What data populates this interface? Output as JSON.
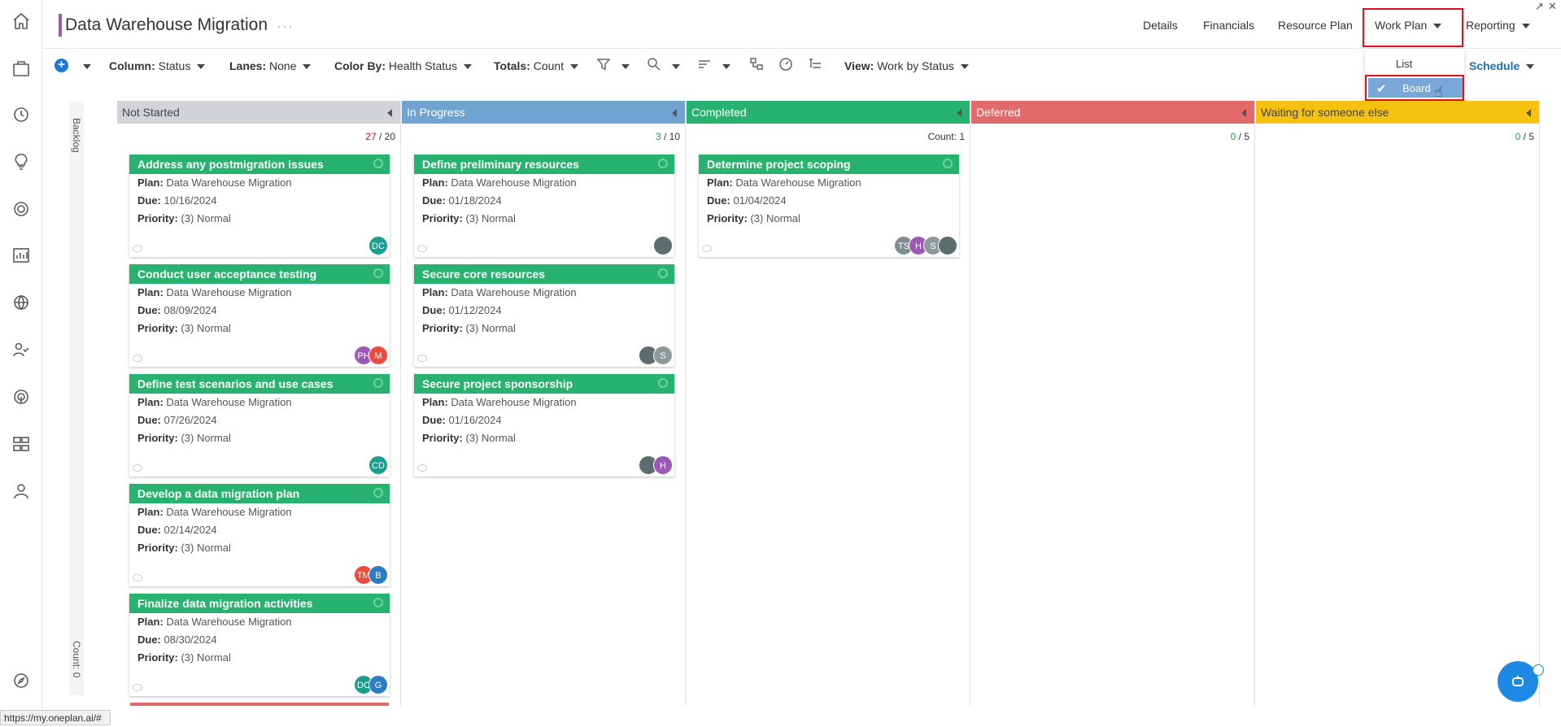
{
  "header": {
    "title": "Data Warehouse Migration",
    "more": "···",
    "nav": {
      "details": "Details",
      "financials": "Financials",
      "resource_plan": "Resource Plan",
      "work_plan": "Work Plan",
      "reporting": "Reporting"
    }
  },
  "toolbar": {
    "column_label": "Column:",
    "column_value": "Status",
    "lanes_label": "Lanes:",
    "lanes_value": "None",
    "color_label": "Color By:",
    "color_value": "Health Status",
    "totals_label": "Totals:",
    "totals_value": "Count",
    "view_label": "View:",
    "view_value": "Work by Status",
    "schedule": "Schedule"
  },
  "work_plan_menu": {
    "list": "List",
    "board": "Board",
    "selected": "Board"
  },
  "backlog": {
    "label": "Backlog",
    "count": "Count: 0"
  },
  "colors": {
    "accent": "#1e78d6",
    "card_header": "#27b36f",
    "highlight": "#e0111a",
    "title_bar": "#9b59b6"
  },
  "columns": [
    {
      "name": "Not Started",
      "color": "#d2d4d8",
      "count_current": "27",
      "count_sep": " / ",
      "count_limit": "20",
      "count_class": "count-red",
      "cards": [
        {
          "title": "Address any postmigration issues",
          "plan": "Data Warehouse Migration",
          "due": "10/16/2024",
          "priority": "(3) Normal",
          "avatars": [
            {
              "t": "DC",
              "c": "#1a9e8f"
            }
          ]
        },
        {
          "title": "Conduct user acceptance testing",
          "plan": "Data Warehouse Migration",
          "due": "08/09/2024",
          "priority": "(3) Normal",
          "avatars": [
            {
              "t": "PH",
              "c": "#9b59b6"
            },
            {
              "t": "M",
              "c": "#e74c3c"
            }
          ]
        },
        {
          "title": "Define test scenarios and use cases",
          "plan": "Data Warehouse Migration",
          "due": "07/26/2024",
          "priority": "(3) Normal",
          "avatars": [
            {
              "t": "CD",
              "c": "#1a9e8f"
            }
          ]
        },
        {
          "title": "Develop a data migration plan",
          "plan": "Data Warehouse Migration",
          "due": "02/14/2024",
          "priority": "(3) Normal",
          "avatars": [
            {
              "t": "TM",
              "c": "#e74c3c"
            },
            {
              "t": "B",
              "c": "#2e7dc4"
            }
          ]
        },
        {
          "title": "Finalize data migration activities",
          "plan": "Data Warehouse Migration",
          "due": "08/30/2024",
          "priority": "(3) Normal",
          "avatars": [
            {
              "t": "DC",
              "c": "#1a9e8f"
            },
            {
              "t": "G",
              "c": "#2e7dc4"
            }
          ]
        }
      ]
    },
    {
      "name": "In Progress",
      "color": "#6fa3d0",
      "count_current": "3",
      "count_sep": " / ",
      "count_limit": "10",
      "count_class": "count-green",
      "cards": [
        {
          "title": "Define preliminary resources",
          "plan": "Data Warehouse Migration",
          "due": "01/18/2024",
          "priority": "(3) Normal",
          "avatars": [
            {
              "t": "",
              "c": "#5d6d6e"
            }
          ]
        },
        {
          "title": "Secure core resources",
          "plan": "Data Warehouse Migration",
          "due": "01/12/2024",
          "priority": "(3) Normal",
          "avatars": [
            {
              "t": "",
              "c": "#5d6d6e"
            },
            {
              "t": "S",
              "c": "#8e9a9a"
            }
          ]
        },
        {
          "title": "Secure project sponsorship",
          "plan": "Data Warehouse Migration",
          "due": "01/16/2024",
          "priority": "(3) Normal",
          "avatars": [
            {
              "t": "",
              "c": "#5d6d6e"
            },
            {
              "t": "H",
              "c": "#9b59b6"
            }
          ]
        }
      ]
    },
    {
      "name": "Completed",
      "color": "#27b36f",
      "count_current": "Count: 1",
      "count_sep": "",
      "count_limit": "",
      "count_class": "",
      "cards": [
        {
          "title": "Determine project scoping",
          "plan": "Data Warehouse Migration",
          "due": "01/04/2024",
          "priority": "(3) Normal",
          "avatars": [
            {
              "t": "TS",
              "c": "#7f8c8d"
            },
            {
              "t": "H",
              "c": "#9b59b6"
            },
            {
              "t": "S",
              "c": "#8e9a9a"
            },
            {
              "t": "",
              "c": "#5d6d6e"
            }
          ]
        }
      ]
    },
    {
      "name": "Deferred",
      "color": "#e26a6a",
      "count_current": "0",
      "count_sep": " / ",
      "count_limit": "5",
      "count_class": "count-green",
      "cards": []
    },
    {
      "name": "Waiting for someone else",
      "color": "#f5c211",
      "count_current": "0",
      "count_sep": " / ",
      "count_limit": "5",
      "count_class": "count-green",
      "cards": []
    }
  ],
  "card_labels": {
    "plan": "Plan:",
    "due": "Due:",
    "priority": "Priority:"
  },
  "statusbar": {
    "url": "https://my.oneplan.ai/#"
  }
}
